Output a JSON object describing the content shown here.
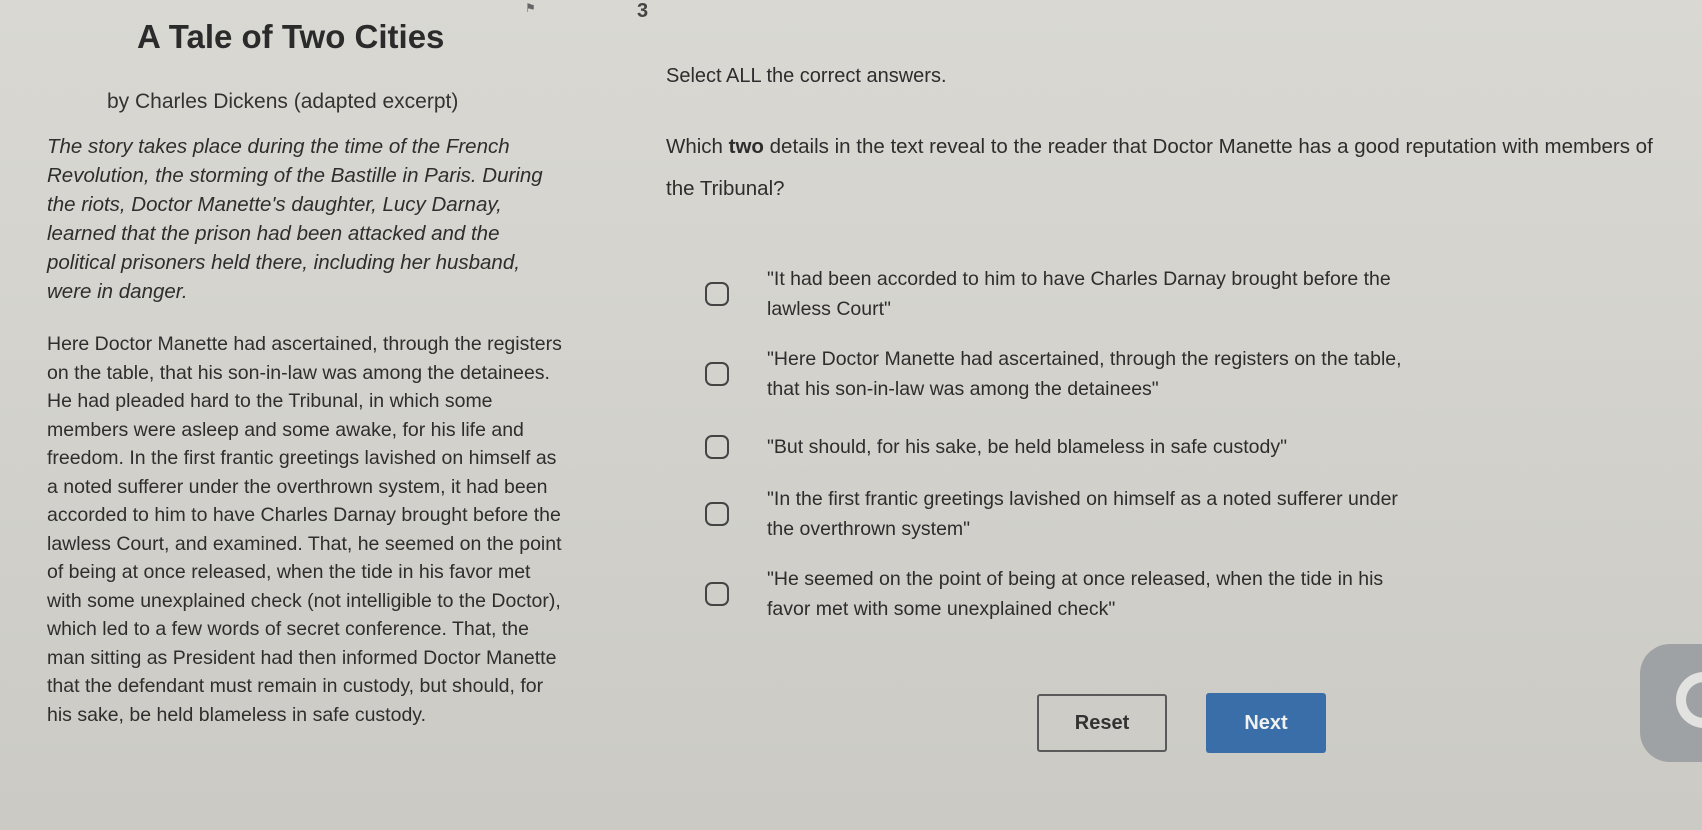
{
  "header": {
    "page_number": "3"
  },
  "passage": {
    "title": "A Tale of Two Cities",
    "author": "by Charles Dickens (adapted excerpt)",
    "intro": "The story takes place during the time of the French Revolution, the storming of the Bastille in Paris. During the riots, Doctor Manette's daughter, Lucy Darnay, learned that the prison had been attacked and the political prisoners held there, including her husband, were in danger.",
    "excerpt": "Here Doctor Manette had ascertained, through the registers on the table, that his son-in-law was among the detainees. He had pleaded hard to the Tribunal, in which some members were asleep and some awake, for his life and freedom. In the first frantic greetings lavished on himself as a noted sufferer under the overthrown system, it had been accorded to him to have Charles Darnay brought before the lawless Court, and examined. That, he seemed on the point of being at once released, when the tide in his favor met with some unexplained check (not intelligible to the Doctor), which led to a few words of secret conference. That, the man sitting as President had then informed Doctor Manette that the defendant must remain in custody, but should, for his sake, be held blameless in safe custody."
  },
  "question": {
    "instruction": "Select ALL the correct answers.",
    "prompt_before": "Which ",
    "prompt_bold": "two",
    "prompt_after": " details in the text reveal to the reader that Doctor Manette has a good reputation with members of the Tribunal?",
    "options": [
      {
        "label": "\"It had been accorded to him to have Charles Darnay brought before the lawless Court\"",
        "selected": false
      },
      {
        "label": "\"Here Doctor Manette had ascertained, through the registers on the table, that his son-in-law was among the detainees\"",
        "selected": false
      },
      {
        "label": "\"But should, for his sake, be held blameless in safe custody\"",
        "selected": false
      },
      {
        "label": "\"In the first frantic greetings lavished on himself as a noted sufferer under the overthrown system\"",
        "selected": false
      },
      {
        "label": "\"He seemed on the point of being at once released, when the tide in his favor met with some unexplained check\"",
        "selected": false
      }
    ]
  },
  "actions": {
    "reset_label": "Reset",
    "next_label": "Next"
  },
  "colors": {
    "background": "#d5d4ce",
    "next_button": "#3a6ea8",
    "side_tab": "#9fa2a4"
  },
  "icons": {
    "flag": "flag-icon",
    "side_tab": "side-tab-icon"
  }
}
